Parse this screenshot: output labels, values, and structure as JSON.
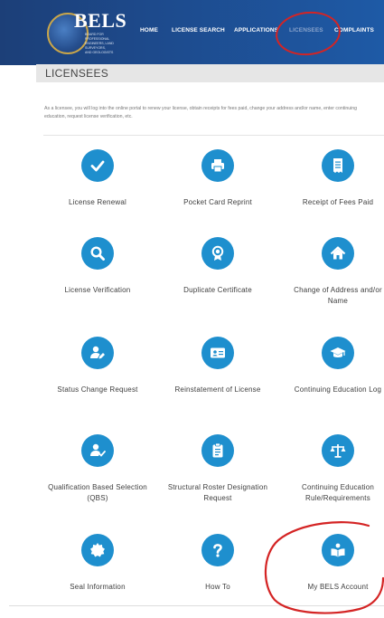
{
  "logo": {
    "title": "BELS",
    "subtitle_lines": [
      "Board for Professional",
      "Engineers, Land Surveyors,",
      "and Geologists"
    ]
  },
  "nav": {
    "items": [
      "HOME",
      "LICENSE SEARCH",
      "APPLICATIONS",
      "LICENSEES",
      "COMPLAINTS"
    ],
    "active": "LICENSEES"
  },
  "page": {
    "title": "LICENSEES",
    "intro": "As a licensee, you will log into the online portal to renew your license, obtain receipts for fees paid, change your address and/or name, enter continuing education, request license verification, etc."
  },
  "tiles": [
    {
      "label": "License Renewal",
      "icon": "checkmark-icon"
    },
    {
      "label": "Pocket Card Reprint",
      "icon": "printer-icon"
    },
    {
      "label": "Receipt of Fees Paid",
      "icon": "receipt-icon"
    },
    {
      "label": "License Verification",
      "icon": "search-icon"
    },
    {
      "label": "Duplicate Certificate",
      "icon": "award-icon"
    },
    {
      "label": "Change of Address and/or Name",
      "icon": "home-icon"
    },
    {
      "label": "Status Change Request",
      "icon": "user-edit-icon"
    },
    {
      "label": "Reinstatement of License",
      "icon": "id-card-icon"
    },
    {
      "label": "Continuing Education Log",
      "icon": "graduation-cap-icon"
    },
    {
      "label": "Qualification Based Selection (QBS)",
      "icon": "user-check-icon"
    },
    {
      "label": "Structural Roster Designation Request",
      "icon": "clipboard-icon"
    },
    {
      "label": "Continuing Education Rule/Requirements",
      "icon": "balance-scale-icon"
    },
    {
      "label": "Seal Information",
      "icon": "seal-icon"
    },
    {
      "label": "How To",
      "icon": "question-icon"
    },
    {
      "label": "My BELS Account",
      "icon": "reader-icon"
    }
  ],
  "colors": {
    "header": "#1d4a8c",
    "icon_circle": "#1e8fce",
    "annotation": "#d42424"
  }
}
